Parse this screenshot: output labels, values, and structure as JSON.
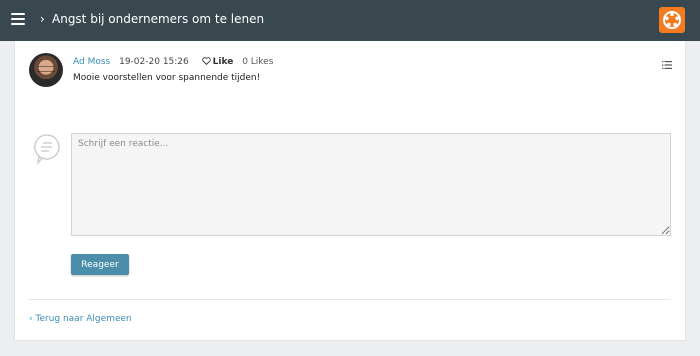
{
  "header": {
    "chevron": "›",
    "title": "Angst bij ondernemers om te lenen"
  },
  "post": {
    "author": "Ad Moss",
    "date": "19-02-20 15:26",
    "like_label": "Like",
    "likes_count": "0 Likes",
    "body": "Mooie voorstellen voor spannende tijden!"
  },
  "comment": {
    "placeholder": "Schrijf een reactie...",
    "submit_label": "Reageer"
  },
  "footer": {
    "back_link": "Terug naar Algemeen",
    "back_chevron": "‹"
  },
  "colors": {
    "topbar": "#39474f",
    "accent": "#3d8eb9",
    "button": "#4a8eaa",
    "logo": "#f47b20"
  }
}
